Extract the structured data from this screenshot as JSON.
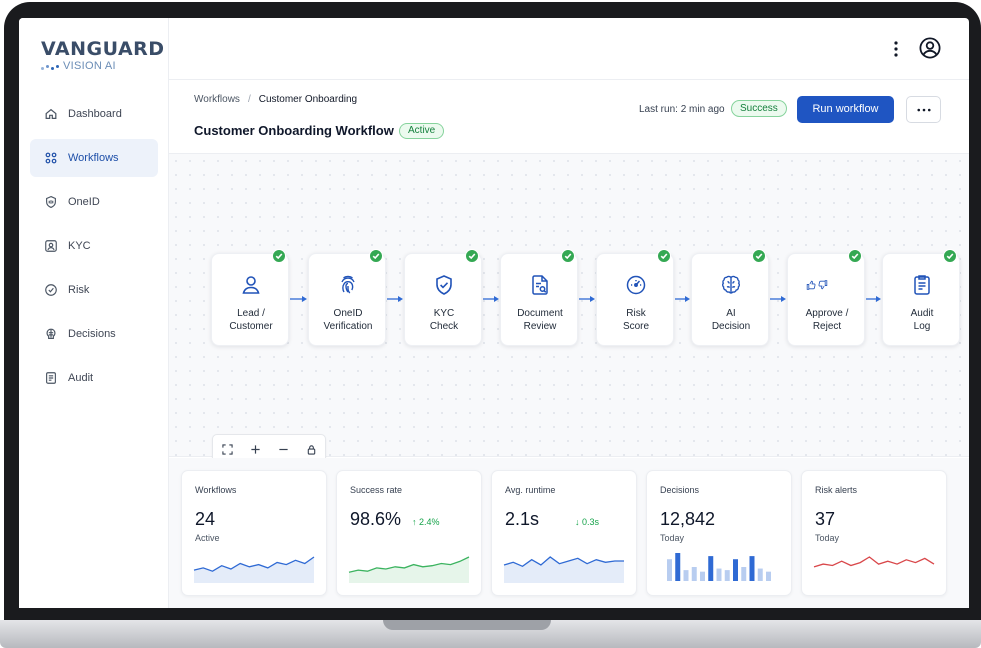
{
  "brand": {
    "name": "VANGUARD",
    "subtitle": "VISION AI",
    "dot_color": "#2d67b7"
  },
  "sidebar": {
    "items": [
      {
        "label": "Dashboard",
        "icon": "home-icon",
        "active": false
      },
      {
        "label": "Workflows",
        "icon": "workflow-grid-icon",
        "active": true
      },
      {
        "label": "OneID",
        "icon": "id-badge-icon",
        "active": false
      },
      {
        "label": "KYC",
        "icon": "person-card-icon",
        "active": false
      },
      {
        "label": "Risk",
        "icon": "risk-gauge-icon",
        "active": false
      },
      {
        "label": "Decisions",
        "icon": "brain-icon",
        "active": false
      },
      {
        "label": "Audit",
        "icon": "audit-document-icon",
        "active": false
      }
    ]
  },
  "topbar": {
    "menu_icon": "kebab-vertical-icon",
    "user_icon": "user-avatar-icon"
  },
  "header": {
    "breadcrumb": [
      "Workflows",
      "Customer Onboarding"
    ],
    "breadcrumb_separator": "/",
    "title": "Customer Onboarding Workflow",
    "status": "Active",
    "last_run": "Last run: 2 min ago",
    "last_run_status": "Success",
    "run_button": "Run workflow",
    "more_icon": "more-horizontal-icon"
  },
  "workflow": {
    "accent": "#1f55c2",
    "check_color": "#34a853",
    "steps": [
      {
        "line1": "Lead /",
        "line2": "Customer",
        "icon": "user-icon",
        "complete": true
      },
      {
        "line1": "OneID",
        "line2": "Verification",
        "icon": "fingerprint-icon",
        "complete": true
      },
      {
        "line1": "KYC",
        "line2": "Check",
        "icon": "shield-check-icon",
        "complete": true
      },
      {
        "line1": "Document",
        "line2": "Review",
        "icon": "document-search-icon",
        "complete": true
      },
      {
        "line1": "Risk",
        "line2": "Score",
        "icon": "gauge-icon",
        "complete": true
      },
      {
        "line1": "AI",
        "line2": "Decision",
        "icon": "brain-icon",
        "complete": true
      },
      {
        "line1": "Approve /",
        "line2": "Reject",
        "icon": "thumbs-up-down-icon",
        "complete": true
      },
      {
        "line1": "Audit",
        "line2": "Log",
        "icon": "audit-log-icon",
        "complete": true
      }
    ],
    "zoom_controls": [
      "fit-view-icon",
      "zoom-in-icon",
      "zoom-out-icon",
      "lock-icon"
    ]
  },
  "stats": {
    "cards": [
      {
        "label": "Workflows",
        "value": "24",
        "sub": "Active",
        "delta": "",
        "spark": "line-blue",
        "series": [
          10,
          12,
          9,
          14,
          11,
          16,
          13,
          15,
          12,
          17,
          15,
          19,
          16,
          22
        ]
      },
      {
        "label": "Success rate",
        "value": "98.6%",
        "sub": "",
        "delta": "↑ 2.4%",
        "spark": "line-green",
        "series": [
          8,
          10,
          9,
          12,
          11,
          13,
          12,
          15,
          13,
          14,
          16,
          15,
          18,
          22
        ]
      },
      {
        "label": "Avg. runtime",
        "value": "2.1s",
        "sub": "",
        "delta": "↓ 0.3s",
        "spark": "line-blue",
        "series": [
          12,
          14,
          11,
          16,
          12,
          18,
          13,
          15,
          17,
          13,
          16,
          14,
          15,
          15
        ]
      },
      {
        "label": "Decisions",
        "value": "12,842",
        "sub": "Today",
        "delta": "",
        "spark": "bars",
        "series": [
          14,
          18,
          7,
          9,
          6,
          16,
          8,
          7,
          14,
          9,
          16,
          8,
          6
        ]
      },
      {
        "label": "Risk alerts",
        "value": "37",
        "sub": "Today",
        "delta": "",
        "spark": "line-red",
        "series": [
          10,
          12,
          11,
          14,
          11,
          13,
          17,
          12,
          14,
          12,
          15,
          13,
          16,
          12
        ]
      }
    ],
    "colors": {
      "blue": "#2f6ad4",
      "green": "#3bb35f",
      "red": "#d9474a",
      "bar_light": "#b8cdf0"
    }
  }
}
